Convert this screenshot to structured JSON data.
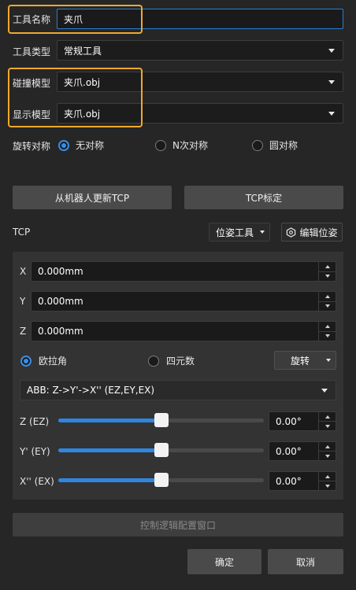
{
  "tool_name": {
    "label": "工具名称",
    "value": "夹爪"
  },
  "tool_type": {
    "label": "工具类型",
    "value": "常规工具"
  },
  "collision_model": {
    "label": "碰撞模型",
    "value": "夹爪.obj"
  },
  "display_model": {
    "label": "显示模型",
    "value": "夹爪.obj"
  },
  "rotation_symmetry": {
    "label": "旋转对称",
    "options": [
      "无对称",
      "N次对称",
      "圆对称"
    ],
    "selected": "无对称"
  },
  "buttons": {
    "update_tcp": "从机器人更新TCP",
    "tcp_calibration": "TCP标定",
    "control_logic": "控制逻辑配置窗口",
    "ok": "确定",
    "cancel": "取消"
  },
  "tcp": {
    "label": "TCP",
    "pose_tool": "位姿工具",
    "edit_pose": "编辑位姿",
    "x": {
      "label": "X",
      "value": "0.000mm"
    },
    "y": {
      "label": "Y",
      "value": "0.000mm"
    },
    "z": {
      "label": "Z",
      "value": "0.000mm"
    },
    "angle_mode": {
      "options": [
        "欧拉角",
        "四元数"
      ],
      "selected": "欧拉角"
    },
    "rotate_label": "旋转",
    "euler_convention": "ABB: Z->Y'->X'' (EZ,EY,EX)",
    "sliders": [
      {
        "label": "Z (EZ)",
        "value": "0.00°",
        "fraction": 0.5
      },
      {
        "label": "Y' (EY)",
        "value": "0.00°",
        "fraction": 0.5
      },
      {
        "label": "X'' (EX)",
        "value": "0.00°",
        "fraction": 0.5
      }
    ]
  },
  "colors": {
    "accent": "#2f86e0",
    "highlight": "#f0a92c"
  }
}
